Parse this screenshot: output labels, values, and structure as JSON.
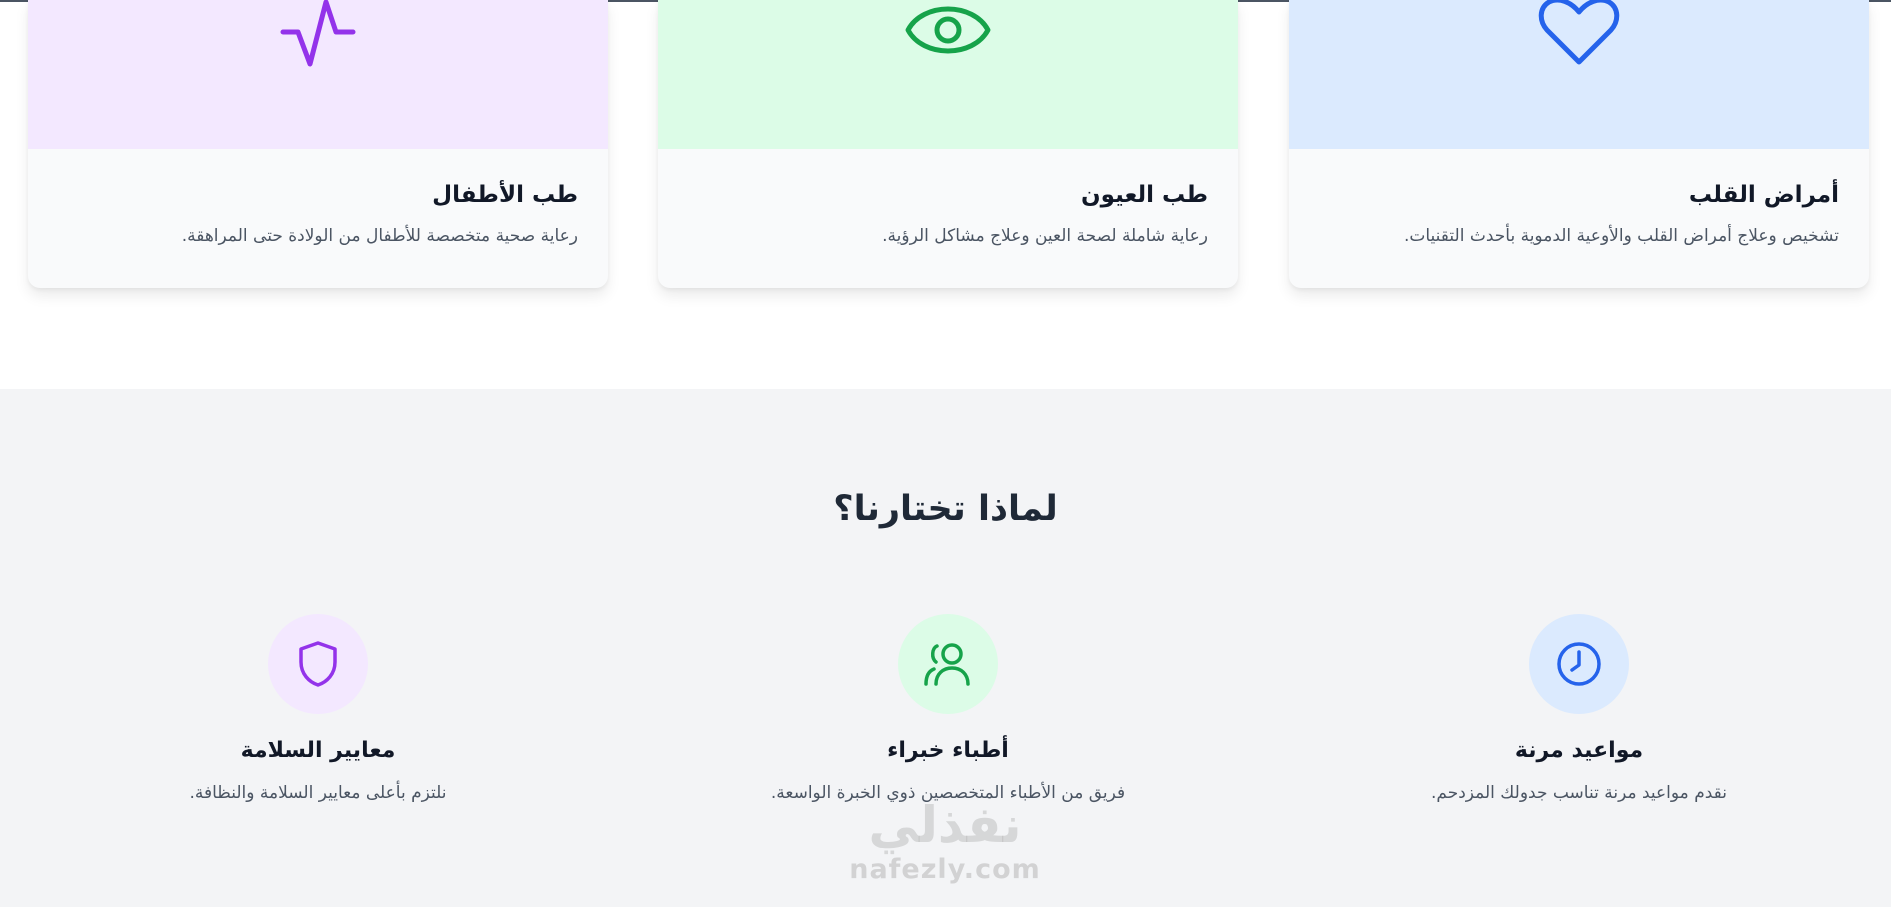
{
  "cards": [
    {
      "title": "أمراض القلب",
      "desc": "تشخيص وعلاج أمراض القلب والأوعية الدموية بأحدث التقنيات.",
      "icon": "heart-icon",
      "bg": "#dbeafe",
      "color": "#2563eb"
    },
    {
      "title": "طب العيون",
      "desc": "رعاية شاملة لصحة العين وعلاج مشاكل الرؤية.",
      "icon": "eye-icon",
      "bg": "#dcfce7",
      "color": "#16a34a"
    },
    {
      "title": "طب الأطفال",
      "desc": "رعاية صحية متخصصة للأطفال من الولادة حتى المراهقة.",
      "icon": "activity-icon",
      "bg": "#f3e8ff",
      "color": "#9333ea"
    }
  ],
  "why": {
    "title": "لماذا تختارنا؟",
    "features": [
      {
        "title": "مواعيد مرنة",
        "desc": "نقدم مواعيد مرنة تناسب جدولك المزدحم.",
        "icon": "clock-icon",
        "bg": "#dbeafe",
        "color": "#2563eb"
      },
      {
        "title": "أطباء خبراء",
        "desc": "فريق من الأطباء المتخصصين ذوي الخبرة الواسعة.",
        "icon": "users-icon",
        "bg": "#dcfce7",
        "color": "#16a34a"
      },
      {
        "title": "معايير السلامة",
        "desc": "نلتزم بأعلى معايير السلامة والنظافة.",
        "icon": "shield-icon",
        "bg": "#f3e8ff",
        "color": "#9333ea"
      }
    ]
  },
  "watermark": {
    "logo_text": "نفذلي",
    "url": "nafezly.com"
  }
}
